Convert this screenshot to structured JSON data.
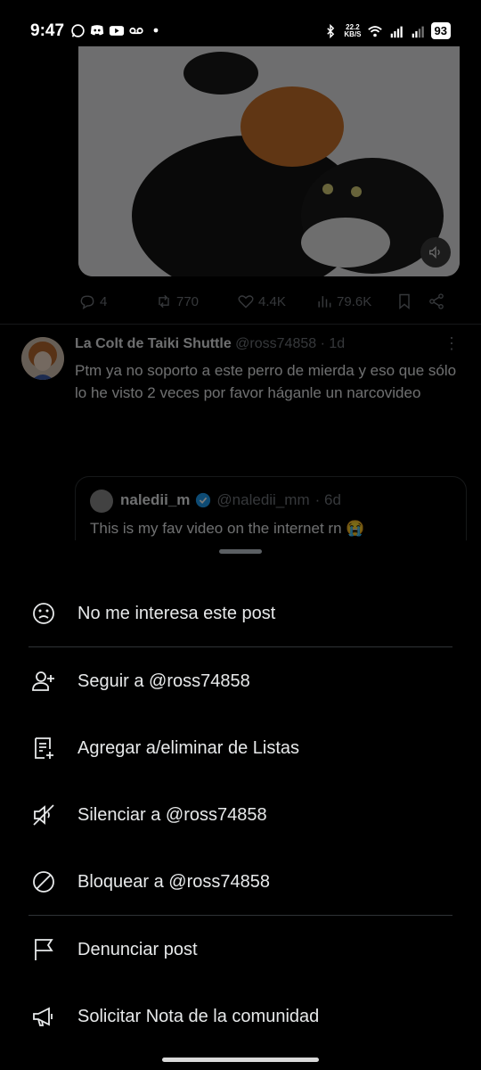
{
  "status_bar": {
    "time": "9:47",
    "speed_top": "22.2",
    "speed_bottom": "KB/S",
    "battery": "93"
  },
  "post1": {
    "actions": {
      "replies": "4",
      "reposts": "770",
      "likes": "4.4K",
      "views": "79.6K"
    }
  },
  "post2": {
    "name": "La Colt de Taiki Shuttle",
    "handle": "@ross74858",
    "time": "· 1d",
    "text": "Ptm ya no soporto a este perro de mierda y eso que sólo lo he visto 2 veces por favor háganle un narcovideo",
    "quote": {
      "name": "naledii_m",
      "handle": "@naledii_mm",
      "time": "· 6d",
      "text": "This is my fav video on the internet rn 😭"
    }
  },
  "menu": {
    "items": [
      {
        "label": "No me interesa este post",
        "icon": "sad-face-icon"
      },
      {
        "label": "Seguir a @ross74858",
        "icon": "follow-user-icon"
      },
      {
        "label": "Agregar a/eliminar de Listas",
        "icon": "list-add-icon"
      },
      {
        "label": "Silenciar a @ross74858",
        "icon": "mute-icon"
      },
      {
        "label": "Bloquear a @ross74858",
        "icon": "block-icon"
      },
      {
        "label": "Denunciar post",
        "icon": "flag-icon"
      },
      {
        "label": "Solicitar Nota de la comunidad",
        "icon": "megaphone-icon"
      }
    ]
  },
  "colors": {
    "background": "#000000",
    "text": "#e7e9ea",
    "muted": "#71767b",
    "divider": "#2f3336",
    "verified": "#1d9bf0"
  }
}
